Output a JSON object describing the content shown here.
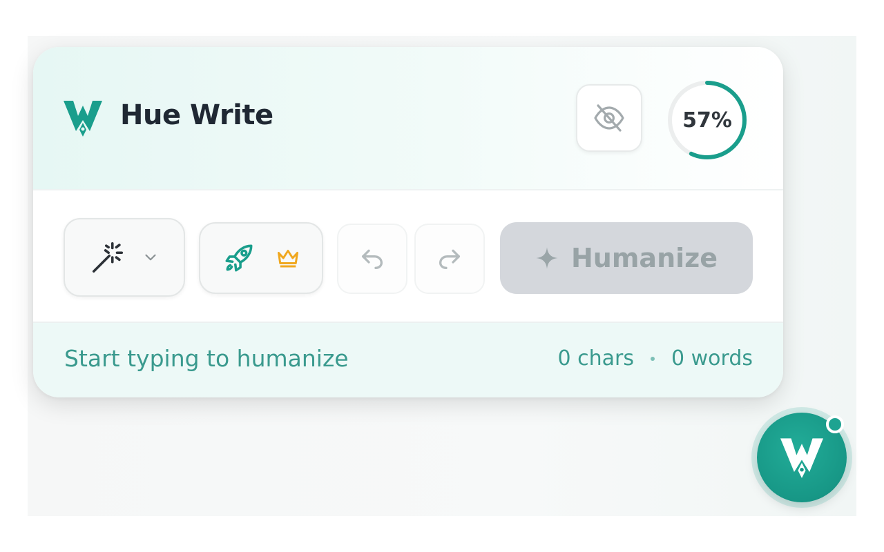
{
  "app": {
    "name": "Hue Write",
    "logo_icon": "hue-write-logo-icon"
  },
  "header": {
    "visibility_icon": "eye-off-icon",
    "progress": {
      "value": 0.57,
      "label": "57%",
      "color": "#1a9e8c",
      "track_color": "#ecefef"
    }
  },
  "toolbar": {
    "mode": {
      "icon": "magic-wand-icon",
      "dropdown_icon": "chevron-down-icon"
    },
    "boost": {
      "icon": "rocket-icon",
      "badge_icon": "crown-icon"
    },
    "undo_icon": "undo-icon",
    "redo_icon": "redo-icon",
    "humanize": {
      "label": "Humanize",
      "icon": "sparkle-icon",
      "disabled": true
    }
  },
  "footer": {
    "status": "Start typing to humanize",
    "chars": "0 chars",
    "separator": "·",
    "words": "0 words"
  },
  "fab": {
    "icon": "hue-write-logo-icon",
    "badge": "notification-dot"
  },
  "colors": {
    "accent": "#1a9e8c",
    "text_dark": "#1f2833",
    "muted_teal": "#3a9a8e",
    "disabled_button": "#d4d7dc",
    "crown": "#f0a820"
  }
}
